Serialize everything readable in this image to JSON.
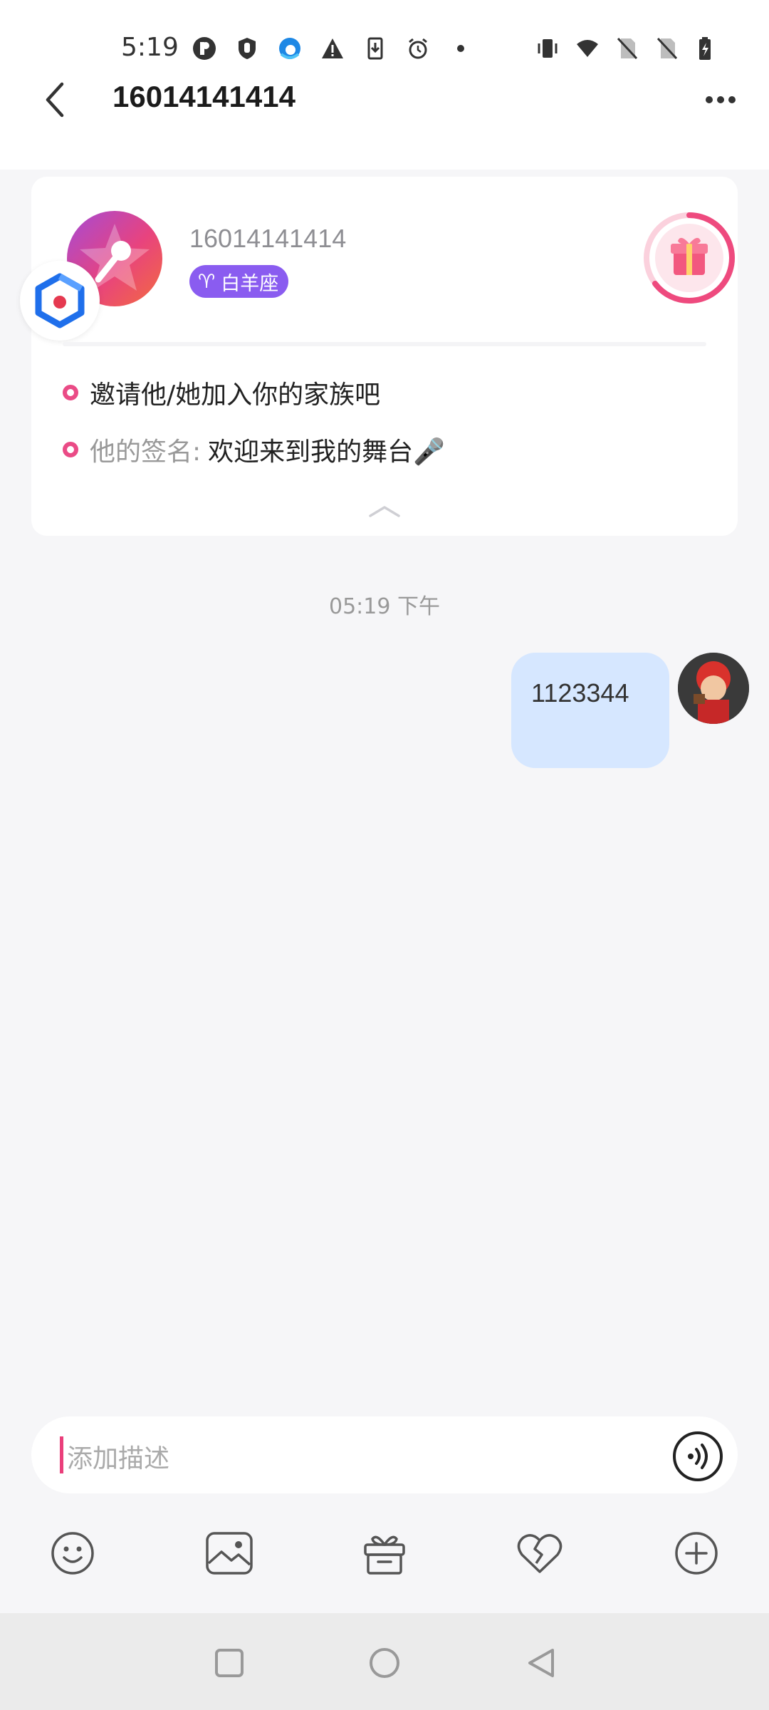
{
  "status_bar": {
    "time": "5:19",
    "left_icons": [
      "notification-p-icon",
      "shield-icon",
      "edge-icon",
      "warning-icon",
      "download-icon",
      "alarm-icon",
      "dot-icon"
    ],
    "right_icons": [
      "vibrate-icon",
      "wifi-icon",
      "no-sim-icon",
      "no-sim-icon",
      "battery-charging-icon"
    ]
  },
  "header": {
    "title": "16014141414"
  },
  "profile_card": {
    "name": "16014141414",
    "zodiac_symbol": "♈",
    "zodiac": "白羊座",
    "invite_text": "邀请他/她加入你的家族吧",
    "signature_label": "他的签名:",
    "signature_value": "欢迎来到我的舞台🎤"
  },
  "chat": {
    "timestamp": "05:19 下午",
    "messages": [
      {
        "from": "me",
        "text": "1123344"
      }
    ]
  },
  "input": {
    "placeholder": "添加描述"
  },
  "toolbar": {
    "icons": [
      "emoji-icon",
      "image-icon",
      "gift-icon",
      "broken-heart-icon",
      "plus-icon"
    ]
  },
  "colors": {
    "accent_pink": "#ea4b86",
    "zodiac_purple": "#8a5cf0",
    "bubble_blue": "#d6e7ff",
    "background": "#f6f6f8"
  }
}
